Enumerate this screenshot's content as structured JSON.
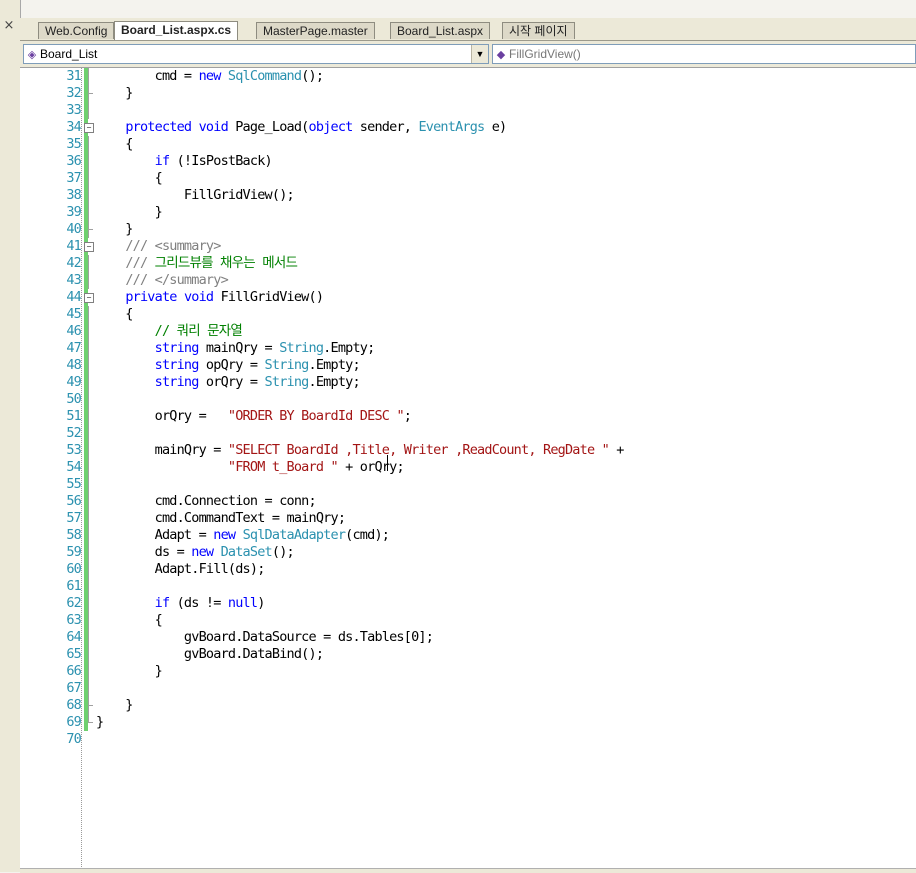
{
  "tabs": [
    {
      "label": "Web.Config",
      "active": false
    },
    {
      "label": "Board_List.aspx.cs",
      "active": true
    },
    {
      "label": "MasterPage.master",
      "active": false
    },
    {
      "label": "Board_List.aspx",
      "active": false
    },
    {
      "label": "시작 페이지",
      "active": false
    }
  ],
  "close_glyph": "×",
  "nav": {
    "class_combo": "Board_List",
    "member_combo": "FillGridView()",
    "dropdown_glyph": "▼"
  },
  "colors": {
    "keyword": "#0000ff",
    "type": "#2b91af",
    "string": "#a31515",
    "comment": "#008000",
    "xmldoc": "#808080",
    "line_number": "#2b91af",
    "change_bar": "#6fd06f"
  },
  "code_lines": [
    {
      "n": "31",
      "t": "        cmd = new SqlCommand();"
    },
    {
      "n": "32",
      "t": "    }"
    },
    {
      "n": "33",
      "t": ""
    },
    {
      "n": "34",
      "t": "    protected void Page_Load(object sender, EventArgs e)"
    },
    {
      "n": "35",
      "t": "    {"
    },
    {
      "n": "36",
      "t": "        if (!IsPostBack)"
    },
    {
      "n": "37",
      "t": "        {"
    },
    {
      "n": "38",
      "t": "            FillGridView();"
    },
    {
      "n": "39",
      "t": "        }"
    },
    {
      "n": "40",
      "t": "    }"
    },
    {
      "n": "41",
      "t": "    /// <summary>"
    },
    {
      "n": "42",
      "t": "    /// 그리드뷰를 채우는 메서드"
    },
    {
      "n": "43",
      "t": "    /// </summary>"
    },
    {
      "n": "44",
      "t": "    private void FillGridView()"
    },
    {
      "n": "45",
      "t": "    {"
    },
    {
      "n": "46",
      "t": "        // 쿼리 문자열"
    },
    {
      "n": "47",
      "t": "        string mainQry = String.Empty;"
    },
    {
      "n": "48",
      "t": "        string opQry = String.Empty;"
    },
    {
      "n": "49",
      "t": "        string orQry = String.Empty;"
    },
    {
      "n": "50",
      "t": ""
    },
    {
      "n": "51",
      "t": "        orQry =   \"ORDER BY BoardId DESC \";"
    },
    {
      "n": "52",
      "t": ""
    },
    {
      "n": "53",
      "t": "        mainQry = \"SELECT BoardId ,Title, Writer ,ReadCount, RegDate \" +"
    },
    {
      "n": "54",
      "t": "                  \"FROM t_Board \" + orQry;"
    },
    {
      "n": "55",
      "t": ""
    },
    {
      "n": "56",
      "t": "        cmd.Connection = conn;"
    },
    {
      "n": "57",
      "t": "        cmd.CommandText = mainQry;"
    },
    {
      "n": "58",
      "t": "        Adapt = new SqlDataAdapter(cmd);"
    },
    {
      "n": "59",
      "t": "        ds = new DataSet();"
    },
    {
      "n": "60",
      "t": "        Adapt.Fill(ds);"
    },
    {
      "n": "61",
      "t": ""
    },
    {
      "n": "62",
      "t": "        if (ds != null)"
    },
    {
      "n": "63",
      "t": "        {"
    },
    {
      "n": "64",
      "t": "            gvBoard.DataSource = ds.Tables[0];"
    },
    {
      "n": "65",
      "t": "            gvBoard.DataBind();"
    },
    {
      "n": "66",
      "t": "        }"
    },
    {
      "n": "67",
      "t": ""
    },
    {
      "n": "68",
      "t": "    }"
    },
    {
      "n": "69",
      "t": "}"
    },
    {
      "n": "70",
      "t": ""
    }
  ]
}
